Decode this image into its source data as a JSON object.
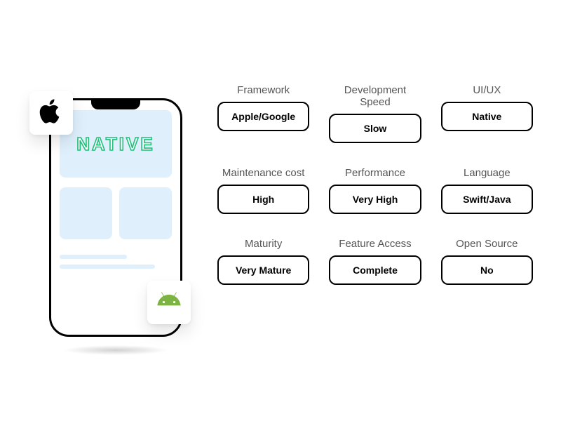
{
  "illustration": {
    "hero_text": "NATIVE",
    "platforms": {
      "apple": "apple-logo",
      "android": "android-logo"
    }
  },
  "attributes": [
    {
      "label": "Framework",
      "value": "Apple/Google"
    },
    {
      "label": "Development Speed",
      "value": "Slow"
    },
    {
      "label": "UI/UX",
      "value": "Native"
    },
    {
      "label": "Maintenance cost",
      "value": "High"
    },
    {
      "label": "Performance",
      "value": "Very High"
    },
    {
      "label": "Language",
      "value": "Swift/Java"
    },
    {
      "label": "Maturity",
      "value": "Very Mature"
    },
    {
      "label": "Feature Access",
      "value": "Complete"
    },
    {
      "label": "Open Source",
      "value": "No"
    }
  ]
}
